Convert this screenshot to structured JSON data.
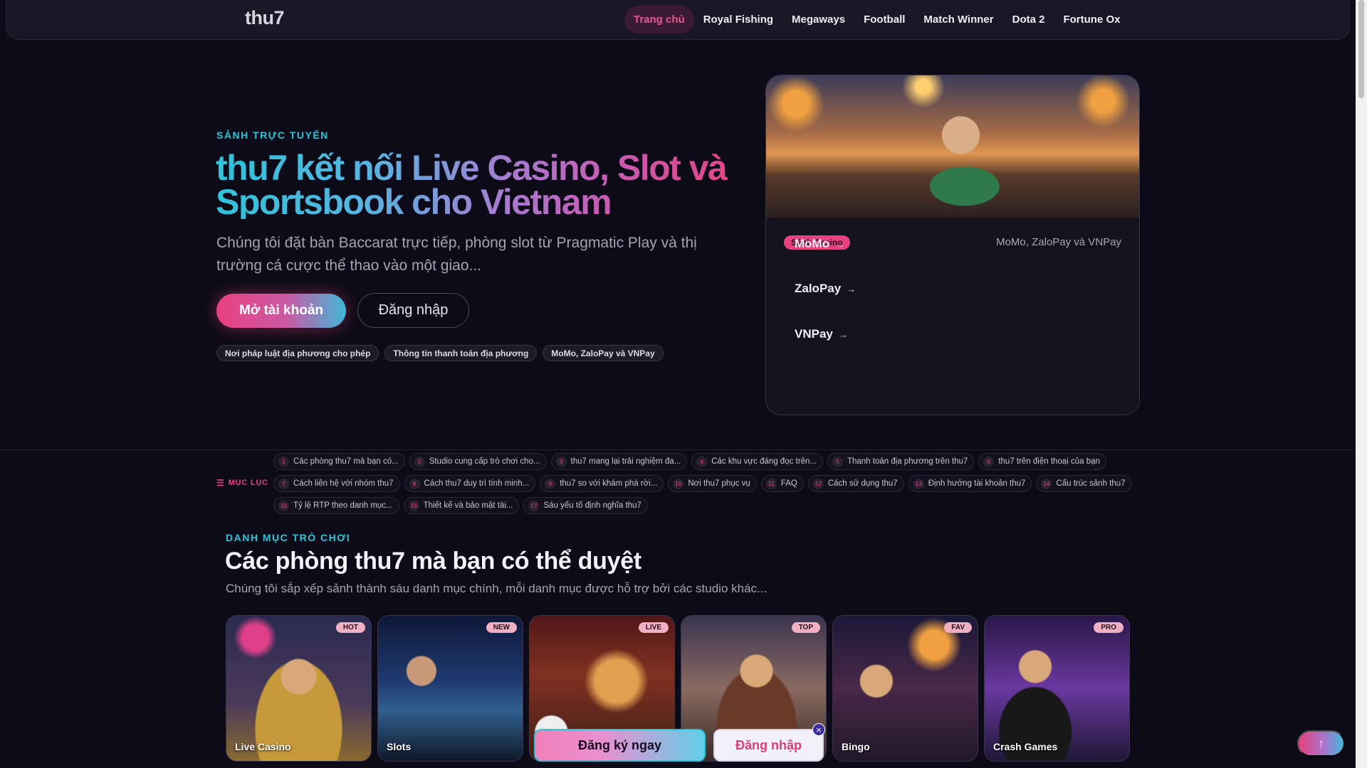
{
  "header": {
    "logo": "thu7",
    "nav": [
      "Trang chủ",
      "Royal Fishing",
      "Megaways",
      "Football",
      "Match Winner",
      "Dota 2",
      "Fortune Ox"
    ],
    "active_index": 0
  },
  "hero": {
    "kicker": "SẢNH TRỰC TUYẾN",
    "title": "thu7 kết nối Live Casino, Slot và Sportsbook cho Vietnam",
    "description": "Chúng tôi đặt bàn Baccarat trực tiếp, phòng slot từ Pragmatic Play và thị trường cá cược thể thao vào một giao...",
    "primary_button": "Mở tài khoản",
    "secondary_button": "Đăng nhập",
    "chips": [
      "Nơi pháp luật địa phương cho phép",
      "Thông tin thanh toán địa phương",
      "MoMo, ZaloPay và VNPay"
    ]
  },
  "hero_card": {
    "badge": "Sảnh Casino",
    "subtitle": "MoMo, ZaloPay và VNPay",
    "links": [
      "MoMo",
      "ZaloPay",
      "VNPay"
    ],
    "arrow": "→"
  },
  "toc": {
    "label": "MỤC LỤC",
    "icon": "list-icon",
    "items": [
      {
        "num": "1",
        "label": "Các phòng thu7 mà bạn có..."
      },
      {
        "num": "2",
        "label": "Studio cung cấp trò chơi cho..."
      },
      {
        "num": "3",
        "label": "thu7 mang lại trải nghiệm đa..."
      },
      {
        "num": "4",
        "label": "Các khu vực đáng đọc trên..."
      },
      {
        "num": "5",
        "label": "Thanh toán địa phương trên thu7"
      },
      {
        "num": "6",
        "label": "thu7 trên điện thoại của bạn"
      },
      {
        "num": "7",
        "label": "Cách liên hệ với nhóm thu7"
      },
      {
        "num": "8",
        "label": "Cách thu7 duy trì tính minh..."
      },
      {
        "num": "9",
        "label": "thu7 so với khám phá rời..."
      },
      {
        "num": "10",
        "label": "Nơi thu7 phục vụ"
      },
      {
        "num": "11",
        "label": "FAQ"
      },
      {
        "num": "12",
        "label": "Cách sử dụng thu7"
      },
      {
        "num": "13",
        "label": "Định hướng tài khoản thu7"
      },
      {
        "num": "14",
        "label": "Cấu trúc sảnh thu7"
      },
      {
        "num": "15",
        "label": "Tỷ lệ RTP theo danh mục..."
      },
      {
        "num": "16",
        "label": "Thiết kế và bảo mật tài..."
      },
      {
        "num": "17",
        "label": "Sáu yếu tố định nghĩa thu7"
      }
    ]
  },
  "games_section": {
    "kicker": "DANH MỤC TRÒ CHƠI",
    "title": "Các phòng thu7 mà bạn có thể duyệt",
    "description": "Chúng tôi sắp xếp sảnh thành sáu danh mục chính, mỗi danh mục được hỗ trợ bởi các studio khác...",
    "cards": [
      {
        "name": "Live Casino",
        "badge": "HOT"
      },
      {
        "name": "Slots",
        "badge": "NEW"
      },
      {
        "name": "",
        "badge": "LIVE"
      },
      {
        "name": "",
        "badge": "TOP"
      },
      {
        "name": "Bingo",
        "badge": "FAV"
      },
      {
        "name": "Crash Games",
        "badge": "PRO"
      }
    ]
  },
  "floating": {
    "register": "Đăng ký ngay",
    "login": "Đăng nhập",
    "close": "×",
    "back_to_top": "↑"
  },
  "colors": {
    "accent_pink": "#e9407f",
    "accent_cyan": "#2ec4d8",
    "background": "#0d0b18"
  }
}
